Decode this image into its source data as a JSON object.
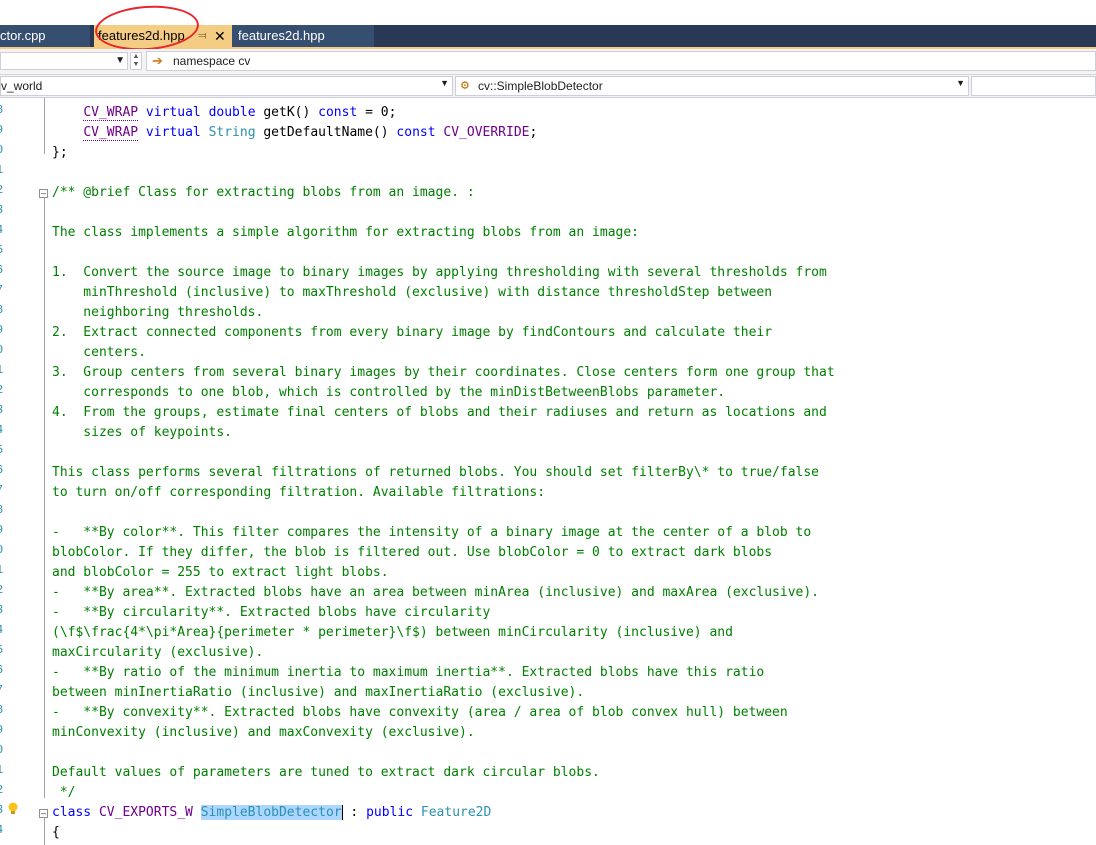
{
  "tabs": [
    {
      "label": "ctor.cpp",
      "active": false
    },
    {
      "label": "features2d.hpp",
      "active": true,
      "pin_icon": "pin-icon",
      "close_icon": "close-icon"
    },
    {
      "label": "features2d.hpp",
      "active": false
    }
  ],
  "nav_row1": {
    "namespace_label": "namespace cv"
  },
  "nav_row2": {
    "project_combo": "v_world",
    "scope_combo": "cv::SimpleBlobDetector",
    "member_combo": ""
  },
  "line_numbers": [
    "8",
    "9",
    "0",
    "1",
    "2",
    "3",
    "4",
    "5",
    "6",
    "7",
    "8",
    "9",
    "0",
    "1",
    "2",
    "3",
    "4",
    "5",
    "6",
    "7",
    "8",
    "9",
    "0",
    "1",
    "2",
    "3",
    "4",
    "5",
    "6",
    "7",
    "8",
    "9",
    "0",
    "1",
    "2",
    "3",
    "4",
    "5",
    "6"
  ],
  "code": {
    "line_getK": [
      "CV_WRAP",
      " virtual ",
      "double",
      " getK() ",
      "const",
      " = 0;"
    ],
    "line_getDefaultName": [
      "CV_WRAP",
      " virtual ",
      "String",
      " getDefaultName() ",
      "const",
      " ",
      "CV_OVERRIDE",
      ";"
    ],
    "line_close": "};",
    "comment_lines": [
      "/** @brief Class for extracting blobs from an image. :",
      "",
      "The class implements a simple algorithm for extracting blobs from an image:",
      "",
      "1.  Convert the source image to binary images by applying thresholding with several thresholds from",
      "    minThreshold (inclusive) to maxThreshold (exclusive) with distance thresholdStep between",
      "    neighboring thresholds.",
      "2.  Extract connected components from every binary image by findContours and calculate their",
      "    centers.",
      "3.  Group centers from several binary images by their coordinates. Close centers form one group that",
      "    corresponds to one blob, which is controlled by the minDistBetweenBlobs parameter.",
      "4.  From the groups, estimate final centers of blobs and their radiuses and return as locations and",
      "    sizes of keypoints.",
      "",
      "This class performs several filtrations of returned blobs. You should set filterBy\\* to true/false",
      "to turn on/off corresponding filtration. Available filtrations:",
      "",
      "-   **By color**. This filter compares the intensity of a binary image at the center of a blob to",
      "blobColor. If they differ, the blob is filtered out. Use blobColor = 0 to extract dark blobs",
      "and blobColor = 255 to extract light blobs.",
      "-   **By area**. Extracted blobs have an area between minArea (inclusive) and maxArea (exclusive).",
      "-   **By circularity**. Extracted blobs have circularity",
      "(\\f$\\frac{4*\\pi*Area}{perimeter * perimeter}\\f$) between minCircularity (inclusive) and",
      "maxCircularity (exclusive).",
      "-   **By ratio of the minimum inertia to maximum inertia**. Extracted blobs have this ratio",
      "between minInertiaRatio (inclusive) and maxInertiaRatio (exclusive).",
      "-   **By convexity**. Extracted blobs have convexity (area / area of blob convex hull) between",
      "minConvexity (inclusive) and maxConvexity (exclusive).",
      "",
      "Default values of parameters are tuned to extract dark circular blobs.",
      " */"
    ],
    "class_line": {
      "kw": "class",
      "macro": "CV_EXPORTS_W",
      "name": "SimpleBlobDetector",
      "rest": " : ",
      "kw2": "public",
      "base": "Feature2D"
    },
    "brace_line": "{"
  },
  "colors": {
    "tab_bar": "#293955",
    "active_tab": "#f5cc84",
    "comment": "#008000",
    "keyword": "#0000ff",
    "macro": "#6f008a",
    "type": "#2b91af",
    "annotation_circle": "#e8262b"
  },
  "icons": [
    "pin-icon",
    "close-icon",
    "chevron-down-icon",
    "arrow-right-icon",
    "scope-icon",
    "lightbulb-icon",
    "collapse-icon"
  ]
}
